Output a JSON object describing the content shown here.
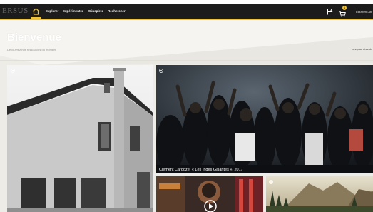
{
  "app": {
    "logo": "ERSUS"
  },
  "nav": {
    "items": [
      {
        "label": "Explorer"
      },
      {
        "label": "Expérimenter"
      },
      {
        "label": "S'inspirer"
      },
      {
        "label": "Rechercher"
      }
    ],
    "cart_count": "1",
    "user_name": "Elizabeth Ab"
  },
  "colors": {
    "accent": "#f2c230",
    "topbar": "#1c1c1c",
    "background": "#eeece7"
  },
  "hero": {
    "title": "Bienvenue",
    "subtitle": "Découvrez nos ressources du moment",
    "sort_link": "Les plus récents"
  },
  "tiles": [
    {
      "name": "house-photo"
    },
    {
      "name": "concert-photo",
      "caption": "Clément Cardoze, « Les Indes Galantes », 2017"
    },
    {
      "name": "neon-photo"
    },
    {
      "name": "valley-photo"
    }
  ],
  "icons": [
    "home-icon",
    "flag-icon",
    "cart-icon",
    "media-icon"
  ]
}
